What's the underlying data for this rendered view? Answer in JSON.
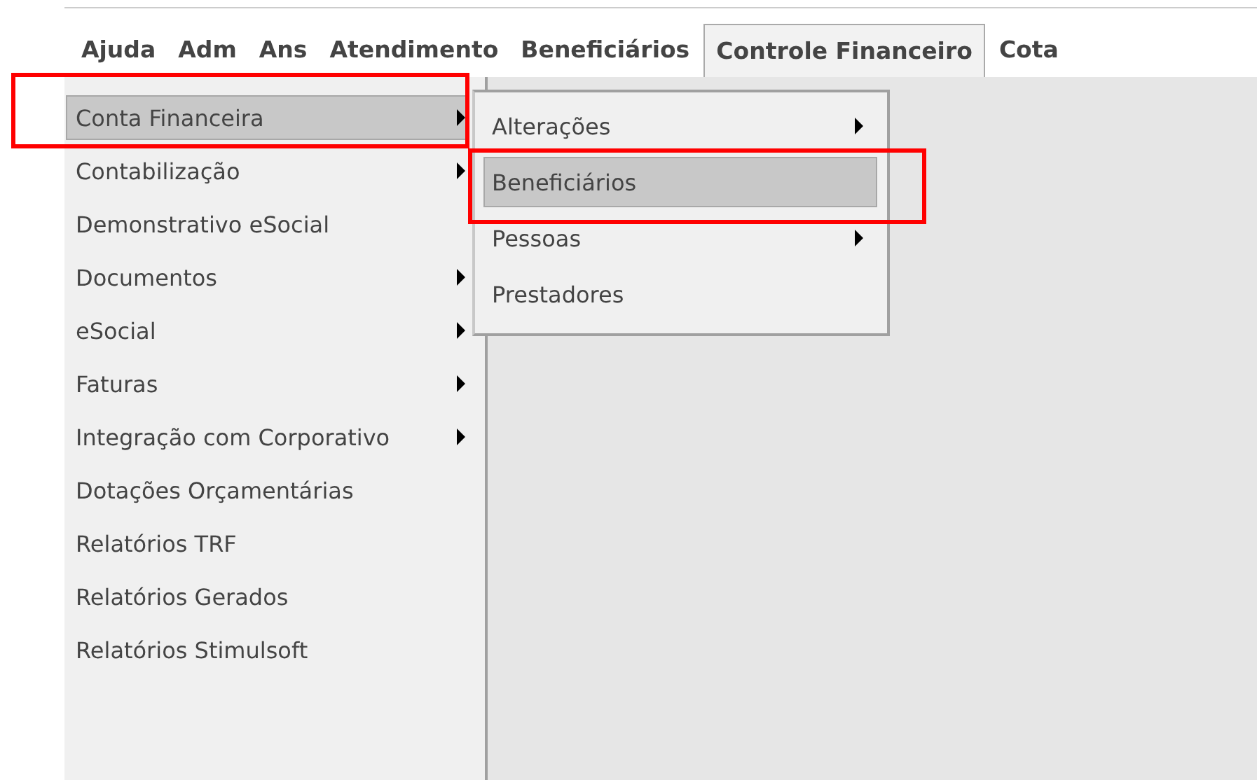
{
  "menubar": [
    {
      "label": "Ajuda",
      "selected": false
    },
    {
      "label": "Adm",
      "selected": false
    },
    {
      "label": "Ans",
      "selected": false
    },
    {
      "label": "Atendimento",
      "selected": false
    },
    {
      "label": "Beneficiários",
      "selected": false
    },
    {
      "label": "Controle Financeiro",
      "selected": true
    },
    {
      "label": "Cota",
      "selected": false
    }
  ],
  "menu": {
    "items": [
      {
        "label": "Conta Financeira",
        "has_submenu": true,
        "selected": true,
        "highlighted": true
      },
      {
        "label": "Contabilização",
        "has_submenu": true,
        "selected": false,
        "highlighted": false
      },
      {
        "label": "Demonstrativo eSocial",
        "has_submenu": false,
        "selected": false,
        "highlighted": false
      },
      {
        "label": "Documentos",
        "has_submenu": true,
        "selected": false,
        "highlighted": false
      },
      {
        "label": "eSocial",
        "has_submenu": true,
        "selected": false,
        "highlighted": false
      },
      {
        "label": "Faturas",
        "has_submenu": true,
        "selected": false,
        "highlighted": false
      },
      {
        "label": "Integração com Corporativo",
        "has_submenu": true,
        "selected": false,
        "highlighted": false
      },
      {
        "label": "Dotações Orçamentárias",
        "has_submenu": false,
        "selected": false,
        "highlighted": false
      },
      {
        "label": "Relatórios TRF",
        "has_submenu": false,
        "selected": false,
        "highlighted": false
      },
      {
        "label": "Relatórios Gerados",
        "has_submenu": false,
        "selected": false,
        "highlighted": false
      },
      {
        "label": "Relatórios Stimulsoft",
        "has_submenu": false,
        "selected": false,
        "highlighted": false
      }
    ]
  },
  "submenu": {
    "items": [
      {
        "label": "Alterações",
        "has_submenu": true,
        "selected": false,
        "highlighted": false
      },
      {
        "label": "Beneficiários",
        "has_submenu": false,
        "selected": true,
        "highlighted": true
      },
      {
        "label": "Pessoas",
        "has_submenu": true,
        "selected": false,
        "highlighted": false
      },
      {
        "label": "Prestadores",
        "has_submenu": false,
        "selected": false,
        "highlighted": false
      }
    ]
  }
}
